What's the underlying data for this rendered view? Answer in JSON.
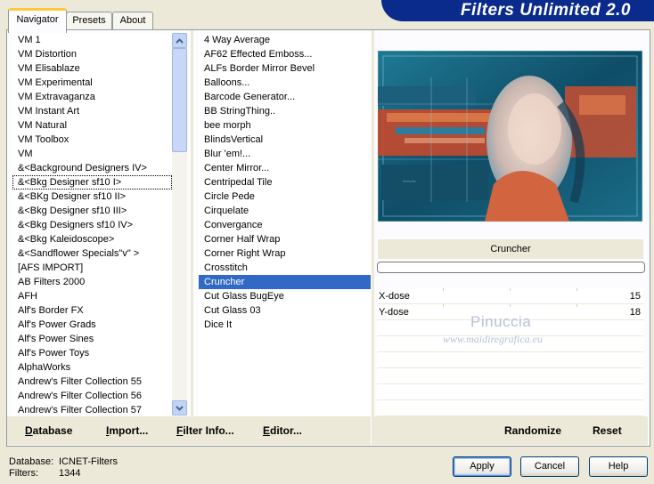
{
  "app": {
    "title": "Filters Unlimited 2.0"
  },
  "tabs": [
    {
      "label": "Navigator",
      "active": true
    },
    {
      "label": "Presets",
      "active": false
    },
    {
      "label": "About",
      "active": false
    }
  ],
  "categories": {
    "items": [
      "VM 1",
      "VM Distortion",
      "VM Elisablaze",
      "VM Experimental",
      "VM Extravaganza",
      "VM Instant Art",
      "VM Natural",
      "VM Toolbox",
      "VM",
      "&<Background Designers IV>",
      "&<Bkg Designer sf10 I>",
      "&<BKg Designer sf10 II>",
      "&<Bkg Designer sf10 III>",
      "&<Bkg Designers sf10 IV>",
      "&<Bkg Kaleidoscope>",
      "&<Sandflower Specials\"v\" >",
      "[AFS IMPORT]",
      "AB Filters 2000",
      "AFH",
      "Alf's Border FX",
      "Alf's Power Grads",
      "Alf's Power Sines",
      "Alf's Power Toys",
      "AlphaWorks",
      "Andrew's Filter Collection 55",
      "Andrew's Filter Collection 56",
      "Andrew's Filter Collection 57"
    ],
    "selected_index": 10
  },
  "filters": {
    "items": [
      "4 Way Average",
      "AF62 Effected Emboss...",
      "ALFs Border Mirror Bevel",
      "Balloons...",
      "Barcode Generator...",
      "BB StringThing..",
      "bee morph",
      "BlindsVertical",
      "Blur 'em!...",
      "Center Mirror...",
      "Centripedal Tile",
      "Circle Pede",
      "Cirquelate",
      "Convergance",
      "Corner Half Wrap",
      "Corner Right Wrap",
      "Crosstitch",
      "Cruncher",
      "Cut Glass  BugEye",
      "Cut Glass 03",
      "Dice It"
    ],
    "selected_index": 17
  },
  "nav_buttons": [
    {
      "label": "Database",
      "hotkey": "D",
      "rest": "atabase"
    },
    {
      "label": "Import...",
      "hotkey": "I",
      "rest": "mport..."
    },
    {
      "label": "Filter Info...",
      "hotkey": "F",
      "rest": "ilter Info..."
    },
    {
      "label": "Editor...",
      "hotkey": "E",
      "rest": "ditor..."
    }
  ],
  "preview": {
    "selected_filter": "Cruncher"
  },
  "parameters": [
    {
      "label": "X-dose",
      "value": "15"
    },
    {
      "label": "Y-dose",
      "value": "18"
    }
  ],
  "watermark": {
    "line1": "Pinuccia",
    "line2": "www.maidiregrafica.eu"
  },
  "right_buttons": {
    "randomize": "Randomize",
    "reset": "Reset"
  },
  "status": {
    "database_label": "Database:",
    "database_value": "ICNET-Filters",
    "filters_label": "Filters:",
    "filters_value": "1344"
  },
  "dialog_buttons": {
    "apply": "Apply",
    "cancel": "Cancel",
    "help": "Help"
  },
  "colors": {
    "selection": "#316ac5",
    "banner": "#0a2a8c",
    "background": "#ece9d8",
    "tab_highlight": "#ffc83c"
  }
}
